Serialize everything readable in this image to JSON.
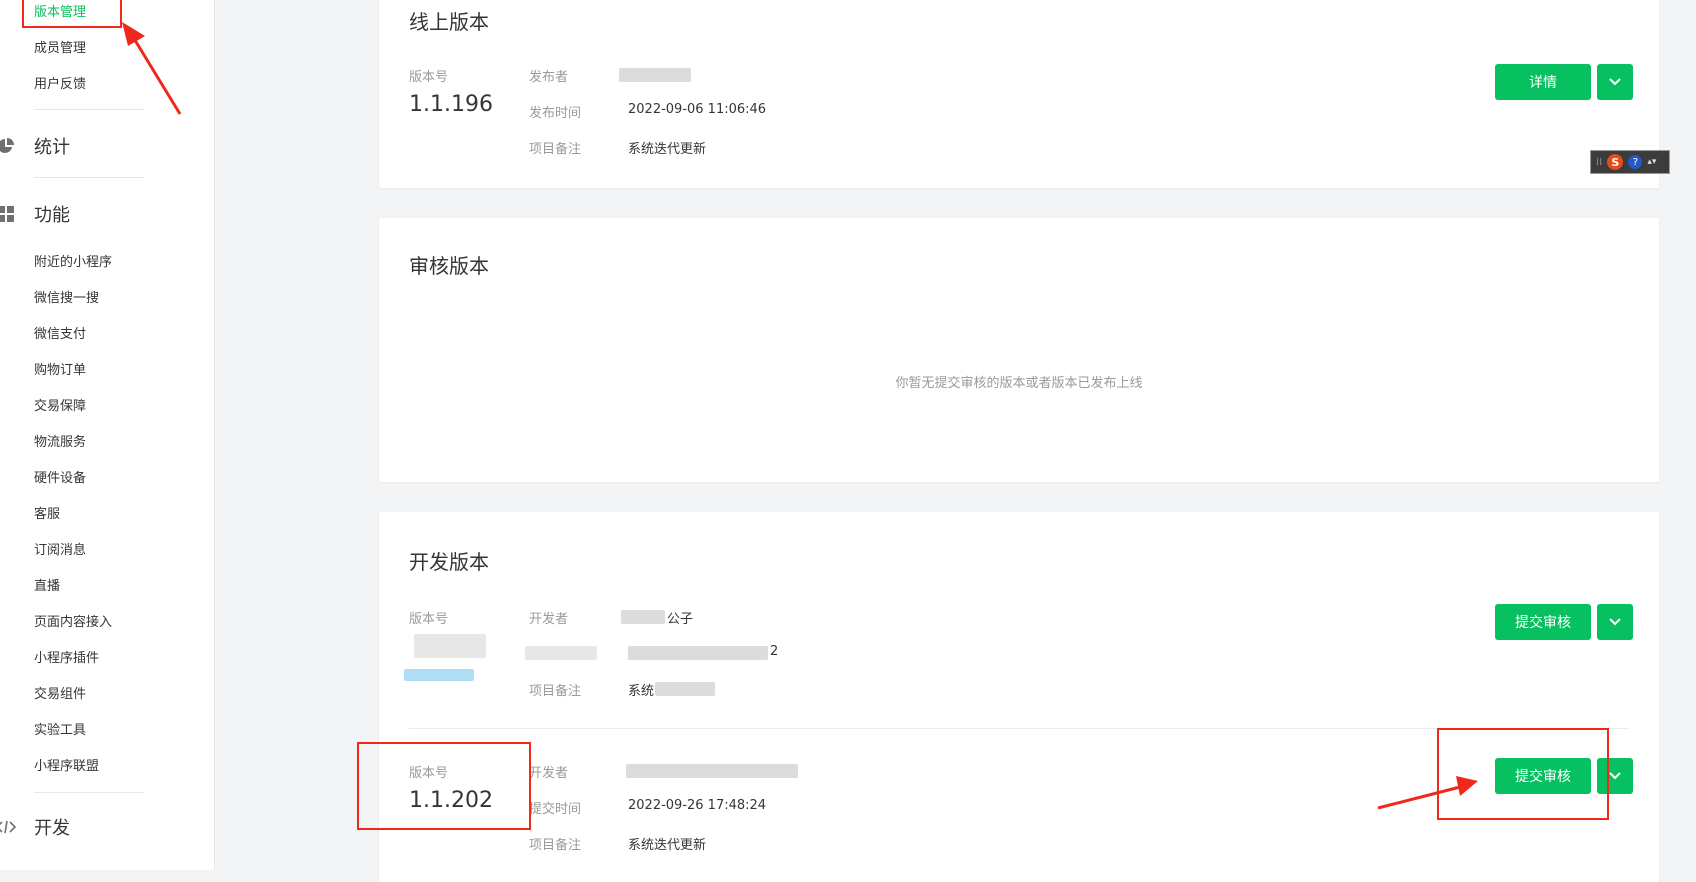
{
  "sidebar": {
    "top_items": [
      "版本管理",
      "成员管理",
      "用户反馈"
    ],
    "groups": {
      "stats": "统计",
      "features": "功能",
      "dev": "开发"
    },
    "feature_items": [
      "附近的小程序",
      "微信搜一搜",
      "微信支付",
      "购物订单",
      "交易保障",
      "物流服务",
      "硬件设备",
      "客服",
      "订阅消息",
      "直播",
      "页面内容接入",
      "小程序插件",
      "交易组件",
      "实验工具",
      "小程序联盟"
    ]
  },
  "online": {
    "title": "线上版本",
    "version_label": "版本号",
    "version": "1.1.196",
    "publisher_label": "发布者",
    "time_label": "发布时间",
    "time": "2022-09-06 11:06:46",
    "note_label": "项目备注",
    "note": "系统迭代更新",
    "detail_btn": "详情"
  },
  "review": {
    "title": "审核版本",
    "empty": "你暂无提交审核的版本或者版本已发布上线"
  },
  "dev": {
    "title": "开发版本",
    "row1": {
      "version_label": "版本号",
      "dev_label": "开发者",
      "dev_suffix": "公子",
      "time_suffix": "2",
      "note_label": "项目备注",
      "note_prefix": "系统",
      "submit_btn": "提交审核"
    },
    "row2": {
      "version_label": "版本号",
      "version": "1.1.202",
      "dev_label": "开发者",
      "time_label": "提交时间",
      "time": "2022-09-26 17:48:24",
      "note_label": "项目备注",
      "note": "系统迭代更新",
      "submit_btn": "提交审核"
    }
  },
  "colors": {
    "accent": "#07c160",
    "annotation": "#f2271c"
  }
}
